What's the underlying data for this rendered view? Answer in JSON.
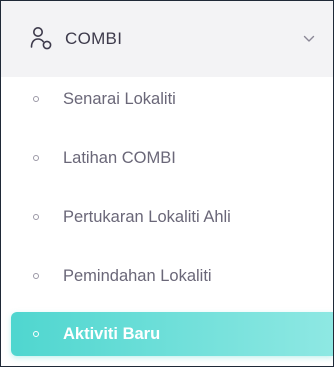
{
  "menu": {
    "header": {
      "title": "COMBI",
      "icon": "users-icon",
      "expand_icon": "chevron-down-icon",
      "expanded": true
    },
    "items": [
      {
        "label": "Senarai Lokaliti",
        "active": false
      },
      {
        "label": "Latihan COMBI",
        "active": false
      },
      {
        "label": "Pertukaran Lokaliti Ahli",
        "active": false
      },
      {
        "label": "Pemindahan Lokaliti",
        "active": false
      },
      {
        "label": "Aktiviti Baru",
        "active": true
      }
    ]
  },
  "colors": {
    "active_gradient_start": "#4fd6cf",
    "active_gradient_end": "#8ee8e3",
    "header_background": "#f3f3f5",
    "text": "#6a6778"
  }
}
